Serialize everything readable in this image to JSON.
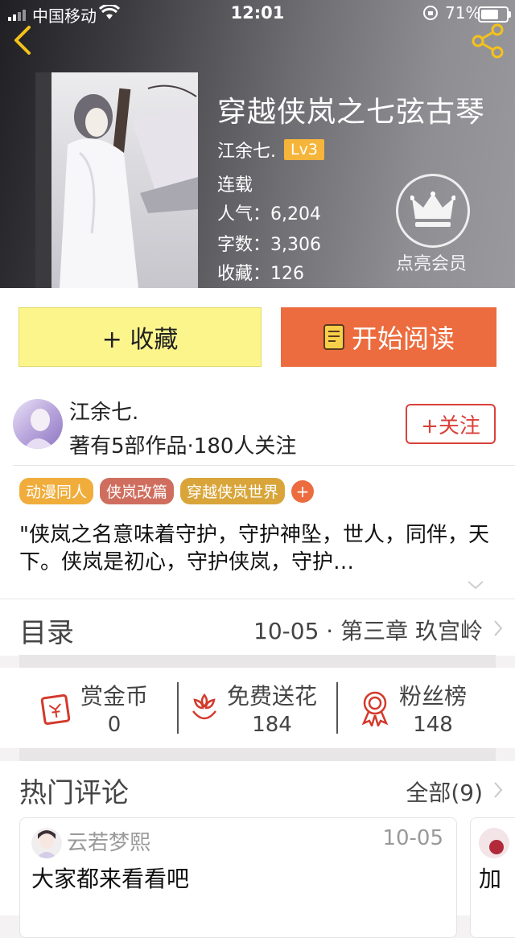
{
  "status_bar": {
    "carrier": "中国移动",
    "time": "12:01",
    "battery_text": "71%",
    "battery_level": 0.71
  },
  "book": {
    "title": "穿越侠岚之七弦古琴",
    "author": "江余七.",
    "level": "Lv3",
    "status": "连载",
    "popularity": "人气：6,204",
    "word_count": "字数：3,306",
    "favorites": "收藏：126"
  },
  "vip": {
    "label": "点亮会员",
    "icon": "crown-icon"
  },
  "actions": {
    "collect": "+ 收藏",
    "read": "开始阅读"
  },
  "author_info": {
    "name": "江余七.",
    "stats": "著有5部作品·180人关注",
    "follow": "+关注"
  },
  "tags": [
    {
      "label": "动漫同人",
      "color": "#f0ad3c"
    },
    {
      "label": "侠岚改篇",
      "color": "#cf6e5e"
    },
    {
      "label": "穿越侠岚世界",
      "color": "#d9a53a"
    }
  ],
  "tag_add": "+",
  "description": "\"侠岚之名意味着守护，守护神坠，世人，同伴，天下。侠岚是初心，守护侠岚，守护…",
  "toc": {
    "title": "目录",
    "latest": "10-05 · 第三章  玖宫岭"
  },
  "stats": [
    {
      "label": "赏金币",
      "value": "0",
      "icon": "red-envelope-icon"
    },
    {
      "label": "免费送花",
      "value": "184",
      "icon": "flower-icon"
    },
    {
      "label": "粉丝榜",
      "value": "148",
      "icon": "medal-icon"
    }
  ],
  "comments": {
    "title": "热门评论",
    "all": "全部(9)",
    "items": [
      {
        "user": "云若梦熙",
        "date": "10-05",
        "text": "大家都来看看吧"
      },
      {
        "text": "加"
      }
    ]
  }
}
